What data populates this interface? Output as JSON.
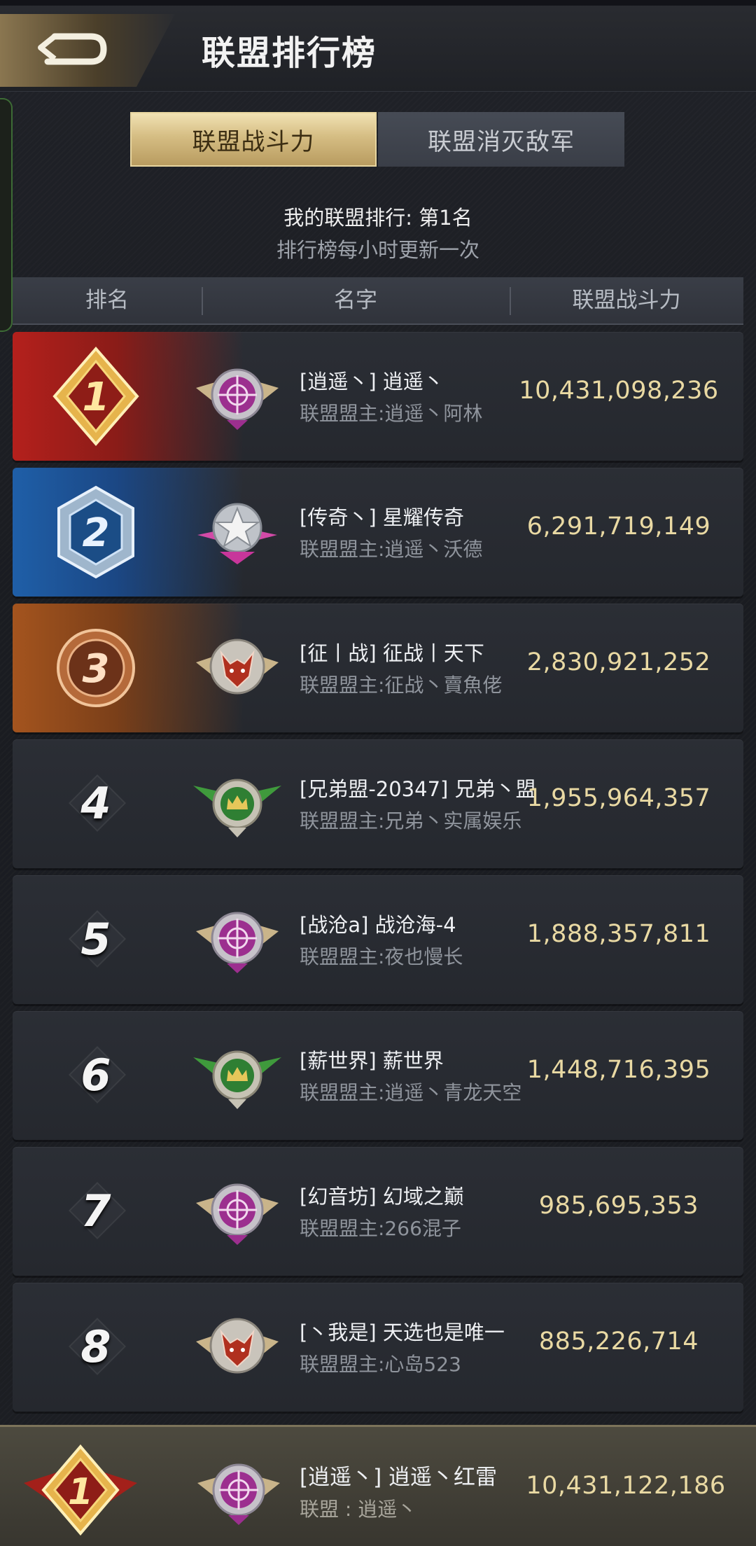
{
  "header": {
    "title": "联盟排行榜",
    "back_icon": "back-arrow-icon"
  },
  "tabs": [
    {
      "label": "联盟战斗力",
      "active": true
    },
    {
      "label": "联盟消灭敌军",
      "active": false
    }
  ],
  "info": {
    "my_rank": "我的联盟排行: 第1名",
    "update_note": "排行榜每小时更新一次"
  },
  "table": {
    "columns": [
      "排名",
      "名字",
      "联盟战斗力"
    ],
    "rows": [
      {
        "rank": "1",
        "tag_name": "[逍遥丶] 逍遥丶",
        "leader": "联盟盟主:逍遥丶阿林",
        "power": "10,431,098,236",
        "emblem": "purple-target-emblem-icon"
      },
      {
        "rank": "2",
        "tag_name": "[传奇丶] 星耀传奇",
        "leader": "联盟盟主:逍遥丶沃德",
        "power": "6,291,719,149",
        "emblem": "pink-star-emblem-icon"
      },
      {
        "rank": "3",
        "tag_name": "[征丨战] 征战丨天下",
        "leader": "联盟盟主:征战丶賣魚佬",
        "power": "2,830,921,252",
        "emblem": "red-fox-emblem-icon"
      },
      {
        "rank": "4",
        "tag_name": "[兄弟盟-20347] 兄弟丶盟",
        "leader": "联盟盟主:兄弟丶实属娱乐",
        "power": "1,955,964,357",
        "emblem": "green-crown-emblem-icon"
      },
      {
        "rank": "5",
        "tag_name": "[战沧a] 战沧海-4",
        "leader": "联盟盟主:夜也慢长",
        "power": "1,888,357,811",
        "emblem": "purple-target-emblem-icon"
      },
      {
        "rank": "6",
        "tag_name": "[薪世界] 薪世界",
        "leader": "联盟盟主:逍遥丶青龙天空",
        "power": "1,448,716,395",
        "emblem": "green-crown-emblem-icon"
      },
      {
        "rank": "7",
        "tag_name": "[幻音坊] 幻域之巅",
        "leader": "联盟盟主:266混子",
        "power": "985,695,353",
        "emblem": "purple-target-emblem-icon"
      },
      {
        "rank": "8",
        "tag_name": "[丶我是] 天选也是唯一",
        "leader": "联盟盟主:心岛523",
        "power": "885,226,714",
        "emblem": "red-fox-emblem-icon"
      }
    ]
  },
  "my_alliance": {
    "rank": "1",
    "tag_name": "[逍遥丶] 逍遥丶红雷",
    "leader": "联盟 : 逍遥丶",
    "power": "10,431,122,186",
    "emblem": "purple-target-emblem-icon"
  },
  "colors": {
    "gold_tab": "#d5bd83",
    "power_text": "#e9d9a3",
    "rank1_bg": "#b4201c",
    "rank2_bg": "#1f5fa8",
    "rank3_bg": "#a4541e"
  }
}
